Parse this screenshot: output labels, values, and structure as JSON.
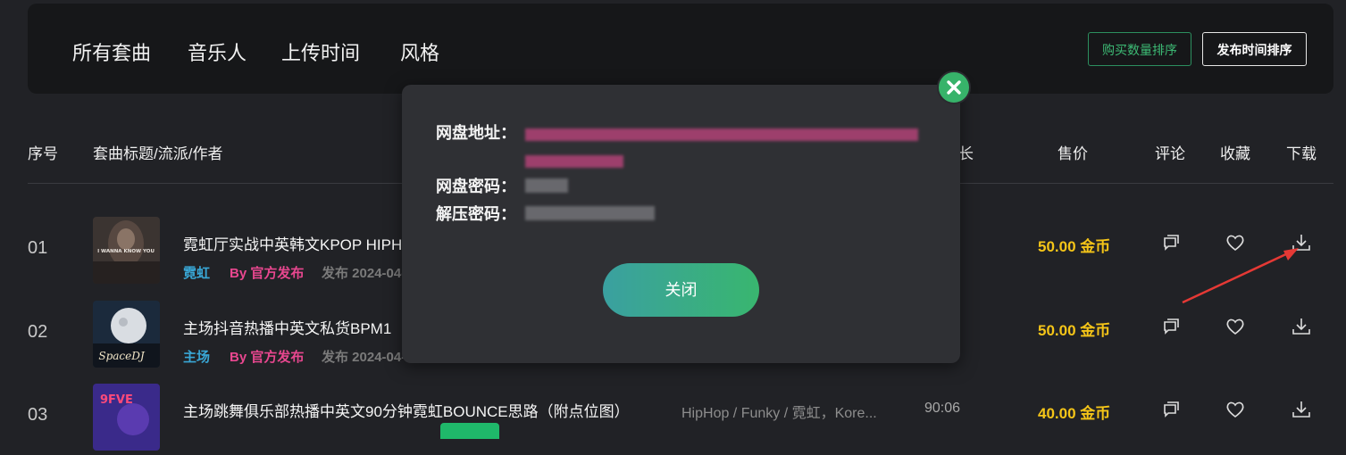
{
  "filters": {
    "tabs": [
      "所有套曲",
      "音乐人",
      "上传时间",
      "风格"
    ],
    "sort_buy_label": "购买数量排序",
    "sort_time_label": "发布时间排序"
  },
  "table": {
    "headers": {
      "num": "序号",
      "title": "套曲标题/流派/作者",
      "duration": "长",
      "price": "售价",
      "comment": "评论",
      "favorite": "收藏",
      "download": "下载"
    },
    "rows": [
      {
        "num": "01",
        "title": "霓虹厅实战中英韩文KPOP HIPH",
        "genre": "霓虹",
        "author": "By 官方发布",
        "date": "发布 2024-04-",
        "style": "",
        "duration": "",
        "price": "50.00 金币",
        "cover_text": "I WANNA KNOW YOU"
      },
      {
        "num": "02",
        "title": "主场抖音热播中英文私货BPM1",
        "genre": "主场",
        "author": "By 官方发布",
        "date": "发布 2024-04-",
        "style": "",
        "duration": "",
        "price": "50.00 金币",
        "cover_text": "SpaceDJ"
      },
      {
        "num": "03",
        "title": "主场跳舞俱乐部热播中英文90分钟霓虹BOUNCE思路（附点位图）",
        "genre": "",
        "author": "",
        "date": "",
        "style": "HipHop / Funky / 霓虹，Kore...",
        "duration": "90:06",
        "price": "40.00 金币",
        "cover_text": "9FVE"
      }
    ]
  },
  "modal": {
    "disk_address_label": "网盘地址：",
    "disk_password_label": "网盘密码：",
    "unzip_password_label": "解压密码：",
    "close_label": "关闭"
  },
  "colors": {
    "background": "#212226",
    "accent_green": "#37b36a",
    "price_gold": "#f5c518",
    "author_pink": "#e8478f",
    "genre_blue": "#39a7d6"
  }
}
